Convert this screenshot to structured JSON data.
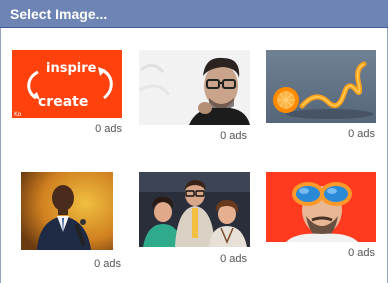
{
  "dialog": {
    "title": "Select Image..."
  },
  "images": [
    {
      "subject": "inspire create sign on orange background",
      "ads_label": "0 ads",
      "top_word": "inspire",
      "bottom_word": "create",
      "small_text": "Ko"
    },
    {
      "subject": "man with glasses portrait",
      "ads_label": "0 ads"
    },
    {
      "subject": "orange peel spiral on blue",
      "ads_label": "0 ads"
    },
    {
      "subject": "speaker in suit with microphone",
      "ads_label": "0 ads"
    },
    {
      "subject": "group of three smiling people",
      "ads_label": "0 ads"
    },
    {
      "subject": "bald bearded man with sunglasses on red",
      "ads_label": "0 ads"
    }
  ],
  "colors": {
    "titlebar": "#6d84b4",
    "accent_orange": "#ff4a12"
  }
}
